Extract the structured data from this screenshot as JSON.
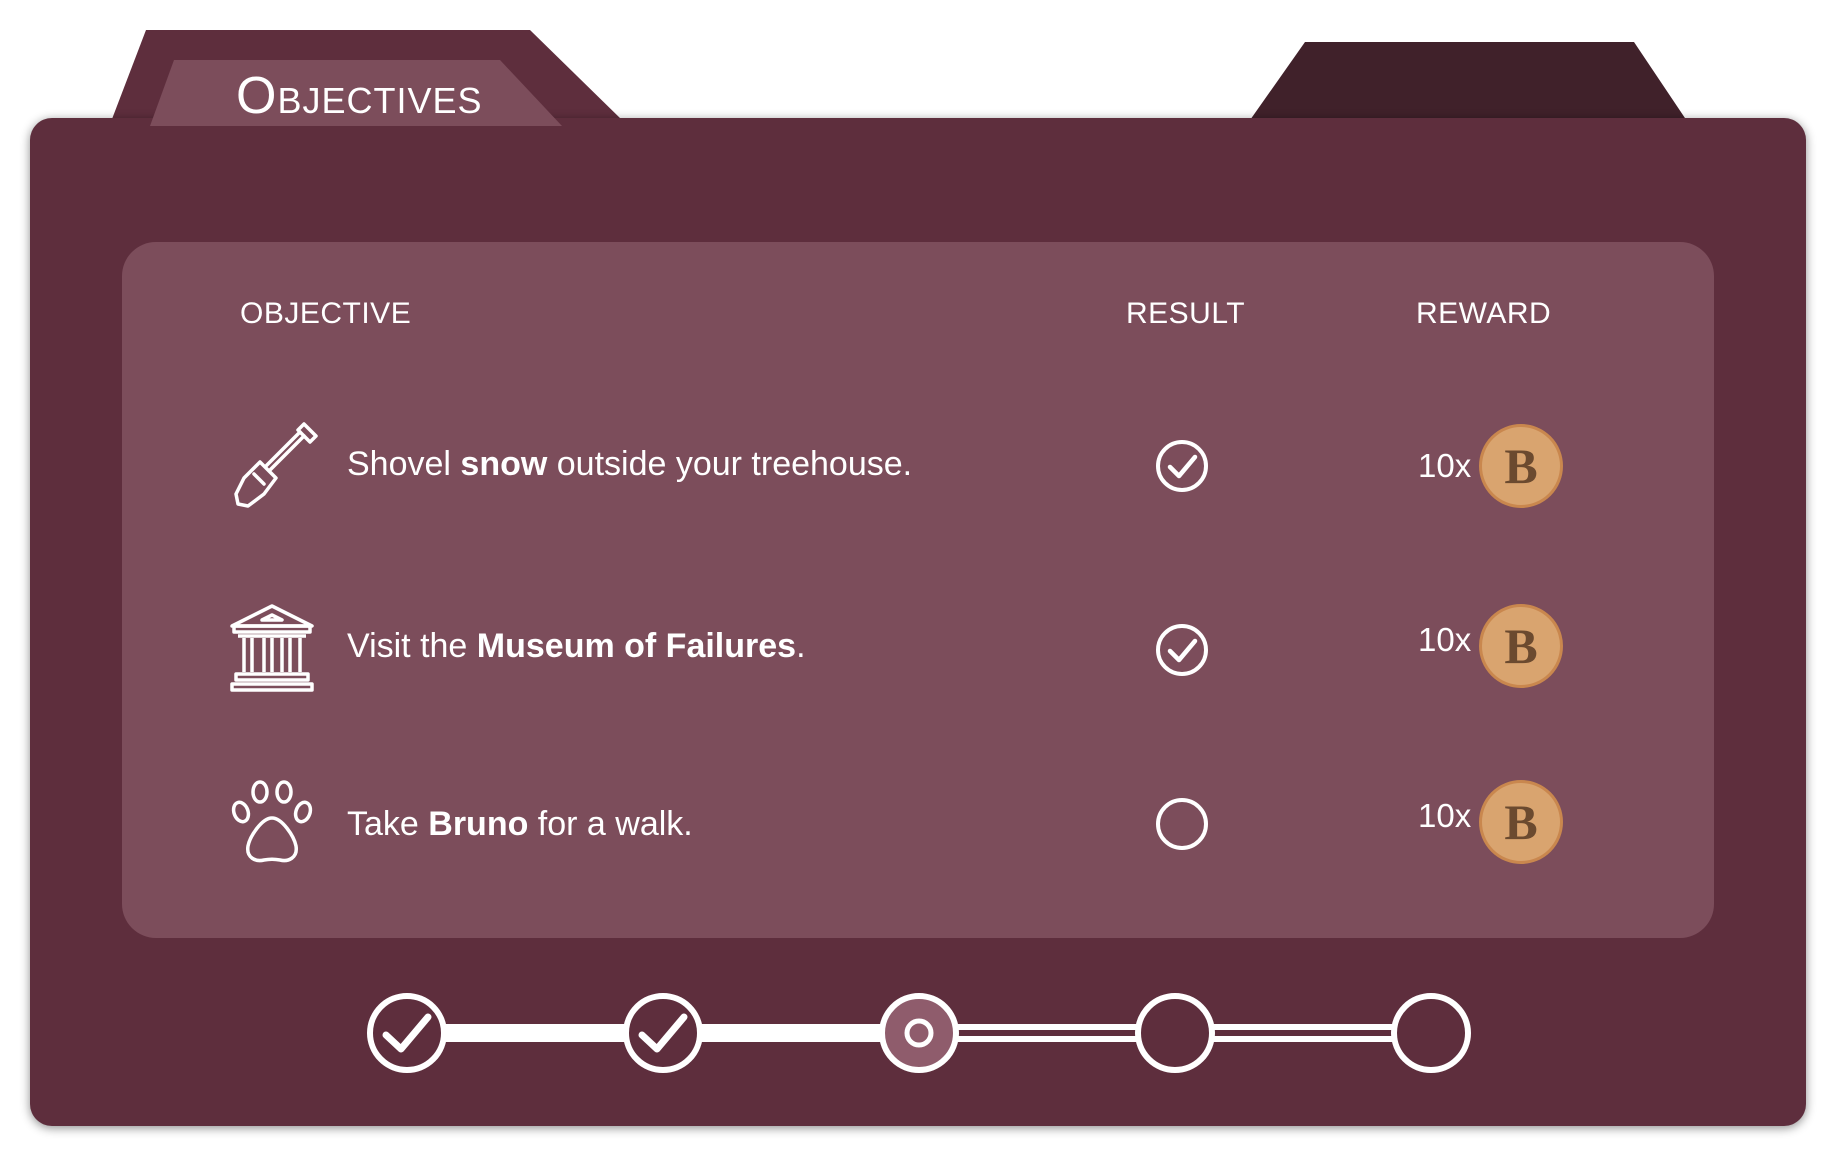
{
  "tab": {
    "title": "Objectives"
  },
  "table": {
    "headers": {
      "objective": "OBJECTIVE",
      "result": "RESULT",
      "reward": "REWARD"
    },
    "rows": [
      {
        "icon": "shovel-icon",
        "text_before": "Shovel ",
        "text_bold": "snow",
        "text_after": " outside your treehouse.",
        "completed": true,
        "reward_count": "10x",
        "reward_coin": "B"
      },
      {
        "icon": "museum-icon",
        "text_before": "Visit the ",
        "text_bold": "Museum of Failures",
        "text_after": ".",
        "completed": true,
        "reward_count": "10x",
        "reward_coin": "B"
      },
      {
        "icon": "paw-icon",
        "text_before": "Take ",
        "text_bold": "Bruno",
        "text_after": " for a walk.",
        "completed": false,
        "reward_count": "10x",
        "reward_coin": "B"
      }
    ]
  },
  "progress": {
    "steps": [
      "completed",
      "completed",
      "current",
      "pending",
      "pending"
    ]
  },
  "colors": {
    "folder": "#5e2e3d",
    "folder_back_tab": "#40212a",
    "tab_highlight": "#7c4d5b",
    "panel": "#7c4d5b",
    "coin_fill": "#d9a46f",
    "coin_border": "#c9874e",
    "white": "#ffffff"
  }
}
